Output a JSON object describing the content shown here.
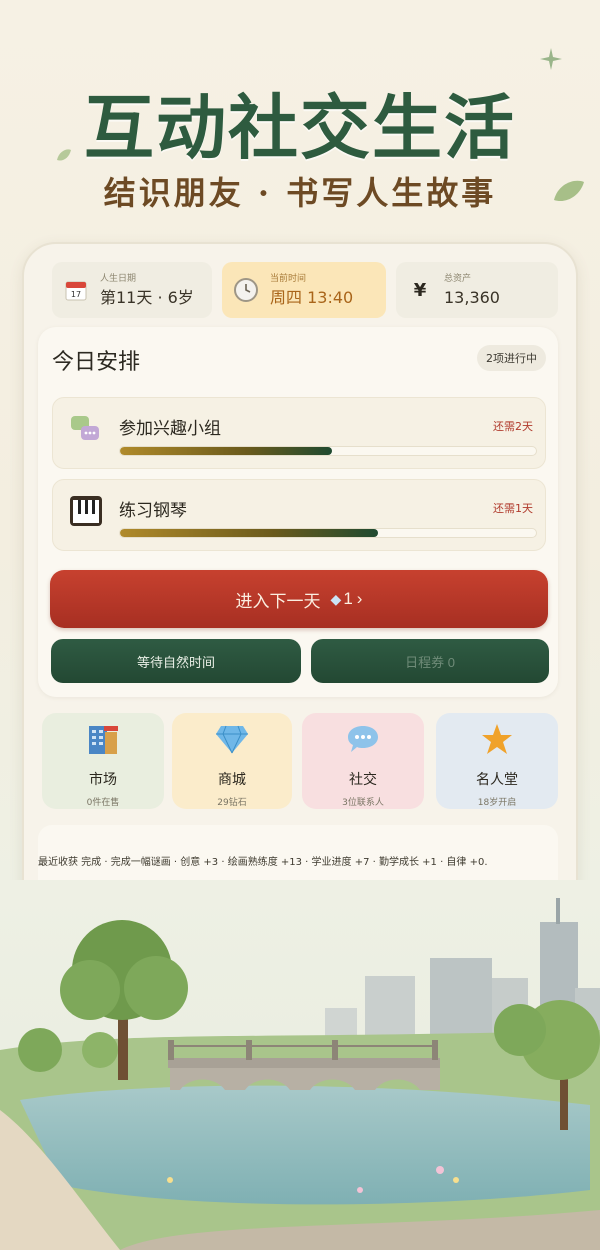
{
  "hero": {
    "title": "互动社交生活",
    "subtitle": "结识朋友 · 书写人生故事"
  },
  "stats": [
    {
      "label": "人生日期",
      "value": "第11天 · 6岁",
      "icon": "calendar-icon"
    },
    {
      "label": "当前时间",
      "value": "周四 13:40",
      "icon": "clock-icon"
    },
    {
      "label": "总资产",
      "value": "13,360",
      "icon": "yen-icon"
    }
  ],
  "today": {
    "title": "今日安排",
    "status": "2项进行中",
    "tasks": [
      {
        "name": "参加兴趣小组",
        "remaining": "还需2天",
        "progress": 0.51,
        "icon": "chat-group-icon"
      },
      {
        "name": "练习钢琴",
        "remaining": "还需1天",
        "progress": 0.62,
        "icon": "piano-icon"
      }
    ]
  },
  "actions": {
    "next_day": "进入下一天",
    "next_day_cost": "1",
    "wait": "等待自然时间",
    "schedule": "日程券 0"
  },
  "tiles": [
    {
      "name": "市场",
      "sub": "0件在售",
      "icon": "building-icon",
      "bg": "#e9eedf"
    },
    {
      "name": "商城",
      "sub": "29钻石",
      "icon": "diamond-icon",
      "bg": "#fbeccb"
    },
    {
      "name": "社交",
      "sub": "3位联系人",
      "icon": "chat-bubble-icon",
      "bg": "#f8dfe0"
    },
    {
      "name": "名人堂",
      "sub": "18岁开启",
      "icon": "star-icon",
      "bg": "#e3eaf1"
    }
  ],
  "harvest": {
    "text": "最近收获  完成 · 完成一幅谜画 · 创意 +3 · 绘画熟练度 +13 · 学业进度 +7 · 勤学成长 +1 · 自律 +0."
  },
  "colors": {
    "accent_green": "#2e5b3f",
    "accent_red": "#b8392a",
    "warning_text": "#b03a2c"
  }
}
